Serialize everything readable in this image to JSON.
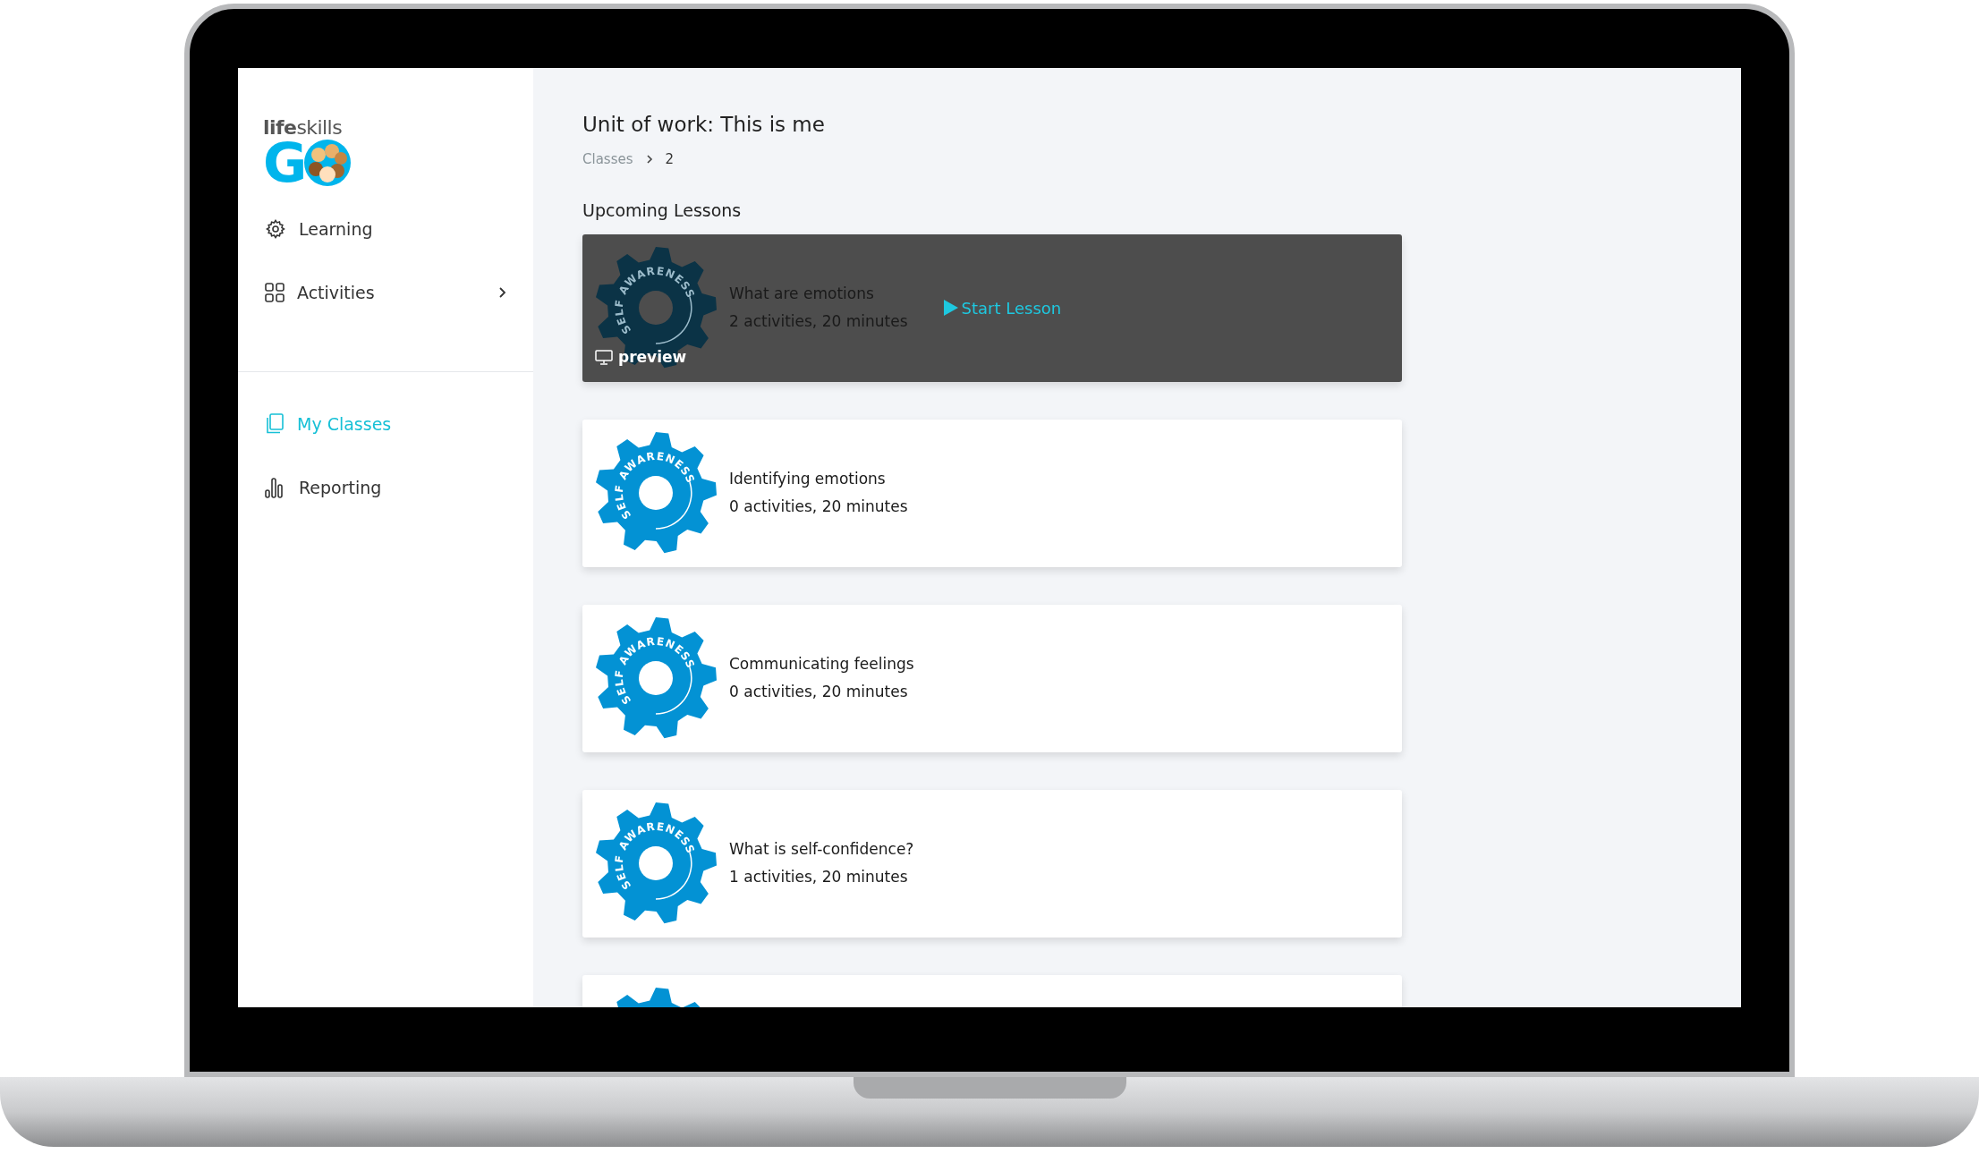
{
  "sidebar": {
    "logo": {
      "wordmark": "**life**skills",
      "letter": "G"
    },
    "nav": [
      {
        "label": "Learning",
        "selected": false,
        "chevron": false
      },
      {
        "label": "Activities",
        "selected": false,
        "chevron": true
      }
    ],
    "nav_secondary": [
      {
        "label": "My Classes",
        "selected": true,
        "chevron": false
      },
      {
        "label": "Reporting",
        "selected": false,
        "chevron": false
      }
    ]
  },
  "main": {
    "title": "Unit of work: This is me",
    "breadcrumb": [
      "Classes",
      "2"
    ],
    "section_title": "Upcoming Lessons",
    "lessons": [
      {
        "badge": "SELF AWARENESS",
        "title": "What are emotions",
        "meta": "2 activities, 20 minutes",
        "highlighted": true,
        "preview": "preview",
        "action": "Start Lesson"
      },
      {
        "badge": "SELF AWARENESS",
        "title": "Identifying emotions",
        "meta": "0 activities, 20 minutes",
        "highlighted": false
      },
      {
        "badge": "SELF AWARENESS",
        "title": "Communicating feelings",
        "meta": "0 activities, 20 minutes",
        "highlighted": false
      },
      {
        "badge": "SELF AWARENESS",
        "title": "What is self-confidence?",
        "meta": "1 activities, 20 minutes",
        "highlighted": false
      },
      {
        "highlighted": false
      }
    ]
  }
}
